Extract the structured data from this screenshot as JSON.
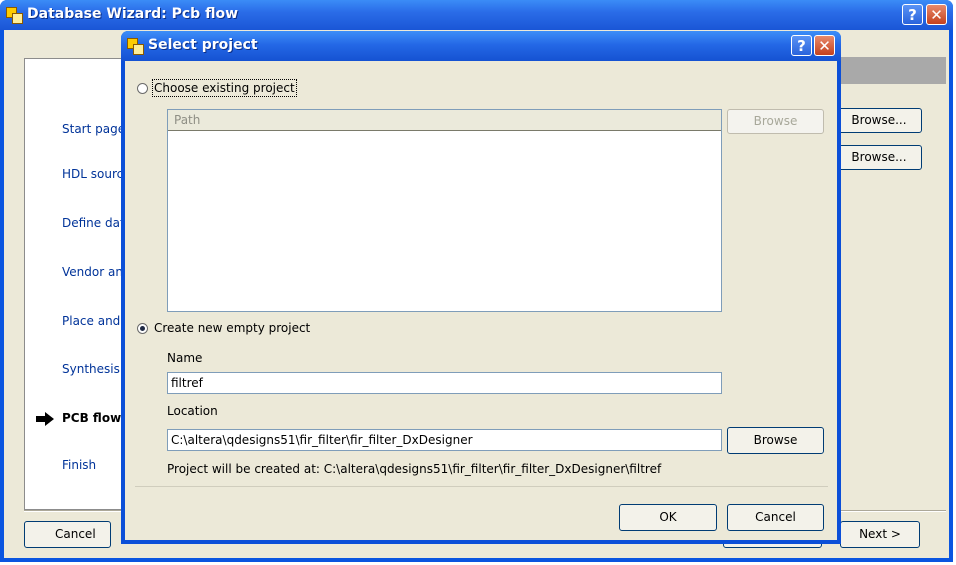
{
  "parent_window": {
    "title": "Database Wizard: Pcb flow",
    "help_glyph": "?",
    "close_glyph": "✕",
    "sidebar": {
      "items": [
        {
          "label": "Start page"
        },
        {
          "label": "HDL source"
        },
        {
          "label": "Define dat"
        },
        {
          "label": "Vendor an"
        },
        {
          "label": "Place and"
        },
        {
          "label": "Synthesis"
        },
        {
          "label": "PCB flow",
          "active": true
        },
        {
          "label": "Finish"
        }
      ]
    },
    "browse_1_label": "Browse...",
    "browse_2_label": "Browse...",
    "cancel_label": "Cancel",
    "next_label": "Next >"
  },
  "dialog": {
    "title": "Select project",
    "help_glyph": "?",
    "close_glyph": "✕",
    "choose_existing_label": "Choose existing project",
    "choose_existing_selected": false,
    "list_header": "Path",
    "browse_existing_label": "Browse",
    "create_new_label": "Create new empty project",
    "create_new_selected": true,
    "name_label": "Name",
    "name_value": "filtref",
    "location_label": "Location",
    "location_value": "C:\\altera\\qdesigns51\\fir_filter\\fir_filter_DxDesigner",
    "browse_location_label": "Browse",
    "created_at_text": "Project will be created at:  C:\\altera\\qdesigns51\\fir_filter\\fir_filter_DxDesigner\\filtref",
    "ok_label": "OK",
    "cancel_label": "Cancel"
  },
  "colors": {
    "titlebar_blue": "#2a6ce8",
    "window_face": "#ece9d8",
    "link_blue": "#003399",
    "close_red": "#c4411e"
  },
  "icons": [
    "app-icon",
    "help-icon",
    "close-icon",
    "arrow-right-icon"
  ]
}
